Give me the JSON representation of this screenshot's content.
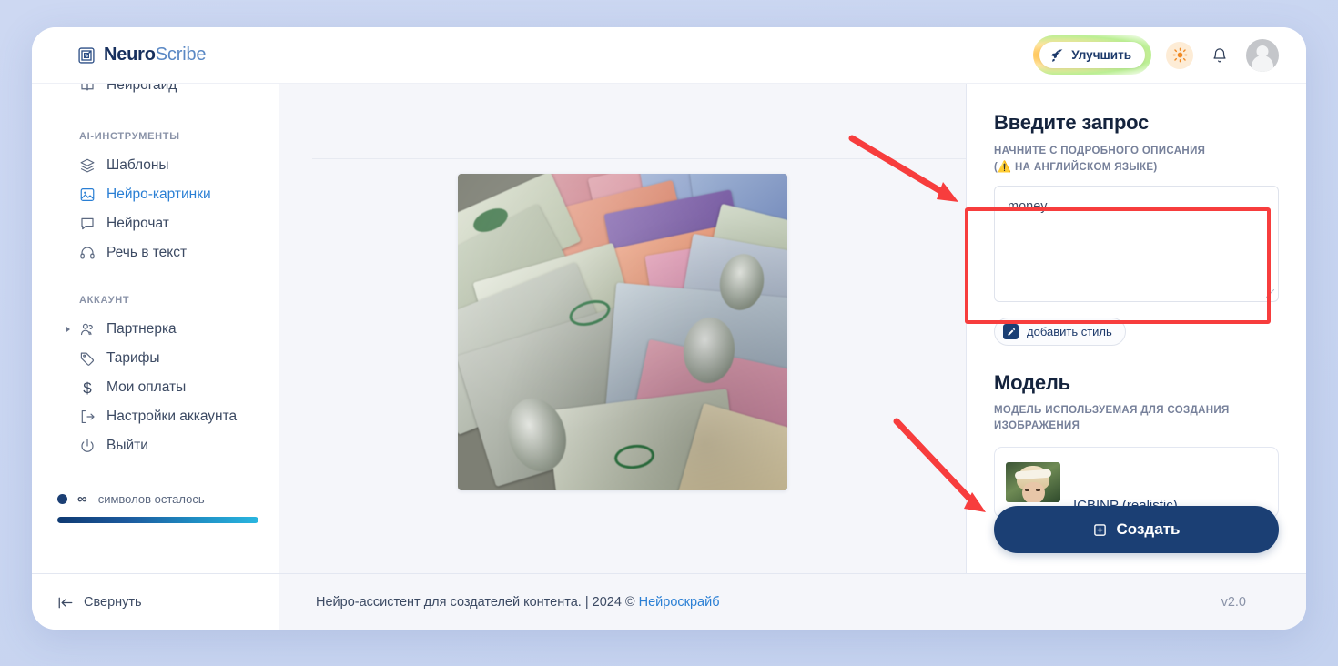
{
  "brand": {
    "name_bold": "Neuro",
    "name_light": "Scribe",
    "logo_icon": "nested-squares-logo-icon"
  },
  "header": {
    "upgrade_label": "Улучшить",
    "upgrade_icon": "rocket-icon",
    "theme_icon": "sun-icon",
    "notifications_icon": "bell-icon",
    "avatar_icon": "user-avatar"
  },
  "sidebar": {
    "clipped_item": {
      "label": "Нейрогайд",
      "icon": "book-icon"
    },
    "groups": [
      {
        "label": "AI-ИНСТРУМЕНТЫ",
        "items": [
          {
            "label": "Шаблоны",
            "icon": "layers-icon",
            "active": false
          },
          {
            "label": "Нейро-картинки",
            "icon": "image-icon",
            "active": true
          },
          {
            "label": "Нейрочат",
            "icon": "chat-bubble-icon",
            "active": false
          },
          {
            "label": "Речь в текст",
            "icon": "headphones-icon",
            "active": false
          }
        ]
      },
      {
        "label": "АККАУНТ",
        "items": [
          {
            "label": "Партнерка",
            "icon": "users-icon",
            "active": false,
            "expandable": true
          },
          {
            "label": "Тарифы",
            "icon": "tag-icon",
            "active": false
          },
          {
            "label": "Мои оплаты",
            "icon": "dollar-icon",
            "active": false
          },
          {
            "label": "Настройки аккаунта",
            "icon": "logout-bracket-icon",
            "active": false
          },
          {
            "label": "Выйти",
            "icon": "power-icon",
            "active": false
          }
        ]
      }
    ],
    "credits": {
      "amount": "∞",
      "label": "символов осталось",
      "bar_percent": 100,
      "bar_gradient_from": "#0f3a72",
      "bar_gradient_to": "#29b6e0"
    },
    "collapse_label": "Свернуть",
    "collapse_icon": "collapse-left-icon"
  },
  "canvas": {
    "image_alt": "Сгенерированное изображение: разбросанные денежные купюры"
  },
  "right_panel": {
    "prompt": {
      "title": "Введите запрос",
      "subtitle_line1": "НАЧНИТЕ С ПОДРОБНОГО ОПИСАНИЯ",
      "subtitle_line2_prefix": "(",
      "subtitle_warn_icon": "⚠️",
      "subtitle_line2": " НА АНГЛИЙСКОМ ЯЗЫКЕ)",
      "value": "money",
      "placeholder": ""
    },
    "style_button": {
      "label": "добавить стиль",
      "icon": "pencil-square-icon"
    },
    "model": {
      "title": "Модель",
      "subtitle": "МОДЕЛЬ ИСПОЛЬЗУЕМАЯ ДЛЯ СОЗДАНИЯ ИЗОБРАЖЕНИЯ",
      "selected_name": "ICBINP (realistic)",
      "thumbnail_alt": "Портрет женщины в светлой повязке"
    },
    "create_button": {
      "label": "Создать",
      "icon": "plus-square-icon",
      "color": "#1b3f74"
    }
  },
  "footer": {
    "tagline": "Нейро-ассистент для создателей контента.",
    "separator": " | ",
    "copyright": "2024 © ",
    "brand_link": "Нейроскрайб",
    "version": "v2.0"
  },
  "annotations": {
    "accent_color": "#f73d3d",
    "highlight_target": "prompt-textarea",
    "arrow_1_target": "prompt-textarea",
    "arrow_2_target": "create-button"
  }
}
